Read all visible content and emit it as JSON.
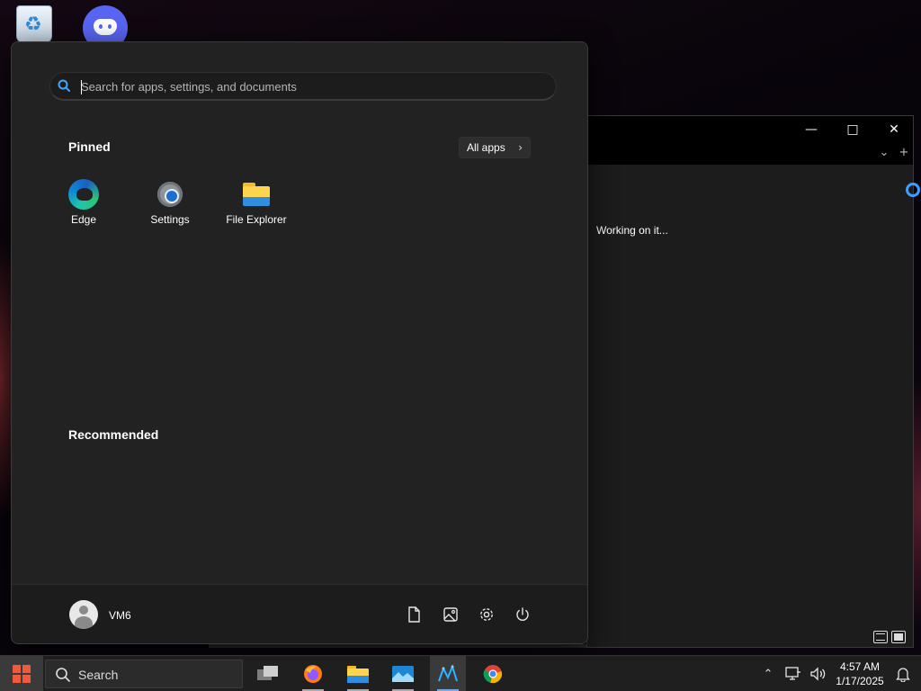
{
  "desktop": {
    "icons": [
      "recycle-bin",
      "discord"
    ]
  },
  "background_window": {
    "status_text": "Working on it...",
    "controls": {
      "minimize": "—",
      "maximize": "□",
      "close": "✕",
      "tab_dropdown": "⌄",
      "new_tab": "+"
    }
  },
  "start_menu": {
    "search_placeholder": "Search for apps, settings, and documents",
    "pinned_title": "Pinned",
    "all_apps_label": "All apps",
    "all_apps_chevron": "›",
    "pinned_apps": [
      {
        "label": "Edge",
        "icon": "edge-icon"
      },
      {
        "label": "Settings",
        "icon": "settings-gear-icon"
      },
      {
        "label": "File Explorer",
        "icon": "folder-icon"
      }
    ],
    "recommended_title": "Recommended",
    "user_name": "VM6",
    "footer_icons": [
      "documents-icon",
      "pictures-icon",
      "settings-icon",
      "power-icon"
    ]
  },
  "taskbar": {
    "search_label": "Search",
    "apps": [
      "task-view",
      "firefox",
      "file-explorer",
      "photos",
      "app-active",
      "chrome"
    ],
    "tray": {
      "overflow_chevron": "⌃",
      "time": "4:57 AM",
      "date": "1/17/2025"
    },
    "accent_color": "#f05a3a"
  }
}
